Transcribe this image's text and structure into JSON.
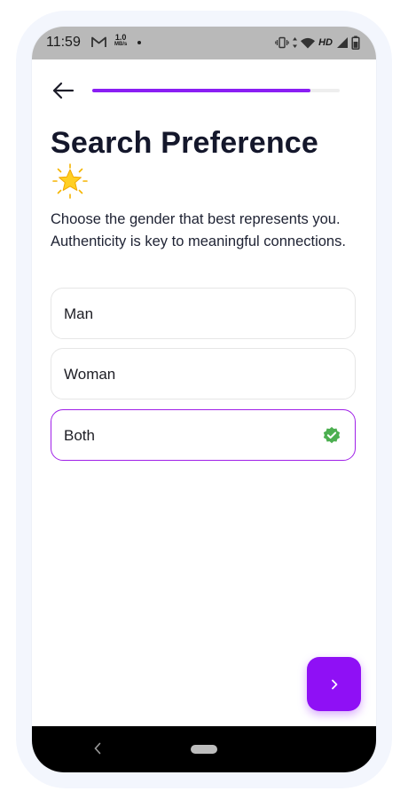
{
  "status_bar": {
    "time": "11:59",
    "speed_value": "1.0",
    "speed_unit": "MB/s",
    "network": "HD",
    "icons": [
      "gmail-icon",
      "vibrate-icon",
      "data-arrows-icon",
      "wifi-icon",
      "signal-icon",
      "battery-icon"
    ]
  },
  "header": {
    "back_icon": "arrow-left-icon",
    "progress": 0.88
  },
  "page": {
    "title": "Search Preference",
    "title_emoji": "star-icon",
    "subtitle": "Choose the gender that best represents you. Authenticity is key to meaningful connections."
  },
  "options": [
    {
      "label": "Man",
      "selected": false
    },
    {
      "label": "Woman",
      "selected": false
    },
    {
      "label": "Both",
      "selected": true
    }
  ],
  "next_button": {
    "icon": "chevron-right-icon"
  },
  "colors": {
    "accent": "#8f10f5",
    "selected_border": "#a020e8",
    "check": "#4caf50",
    "title": "#14172b"
  },
  "nav_bar": {
    "icons": [
      "nav-back-icon",
      "nav-home-pill"
    ]
  }
}
